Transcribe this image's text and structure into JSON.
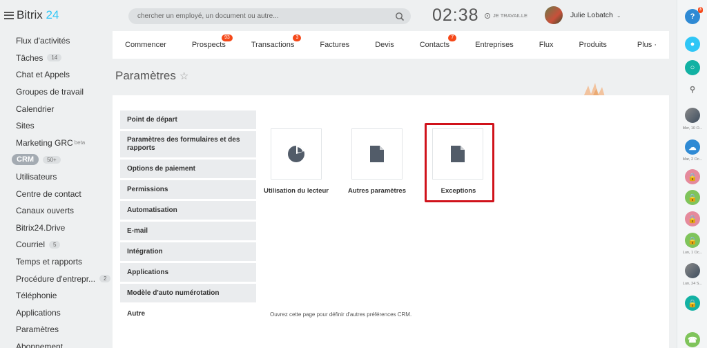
{
  "app": {
    "name_part1": "Bitrix",
    "name_part2": "24"
  },
  "search": {
    "placeholder": "chercher un employé, un document ou autre..."
  },
  "clock": {
    "time": "02:38",
    "status": "JE TRAVAILLE"
  },
  "user": {
    "name": "Julie Lobatch"
  },
  "sidebar": {
    "items": [
      {
        "label": "Flux d'activités"
      },
      {
        "label": "Tâches",
        "badge": "14"
      },
      {
        "label": "Chat et Appels"
      },
      {
        "label": "Groupes de travail"
      },
      {
        "label": "Calendrier"
      },
      {
        "label": "Sites"
      },
      {
        "label": "Marketing GRC",
        "sup": "beta"
      },
      {
        "label": "CRM",
        "badge": "50+"
      },
      {
        "label": "Utilisateurs"
      },
      {
        "label": "Centre de contact"
      },
      {
        "label": "Canaux ouverts"
      },
      {
        "label": "Bitrix24.Drive"
      },
      {
        "label": "Courriel",
        "badge": "5"
      },
      {
        "label": "Temps et rapports"
      },
      {
        "label": "Procédure d'entrepr...",
        "badge": "2"
      },
      {
        "label": "Téléphonie"
      },
      {
        "label": "Applications"
      },
      {
        "label": "Paramètres"
      },
      {
        "label": "Abonnement"
      }
    ]
  },
  "topnav": {
    "items": [
      {
        "label": "Commencer"
      },
      {
        "label": "Prospects",
        "count": "93"
      },
      {
        "label": "Transactions",
        "count": "3"
      },
      {
        "label": "Factures"
      },
      {
        "label": "Devis"
      },
      {
        "label": "Contacts",
        "count": "7"
      },
      {
        "label": "Entreprises"
      },
      {
        "label": "Flux"
      },
      {
        "label": "Produits"
      },
      {
        "label": "Plus ·"
      }
    ]
  },
  "page": {
    "title": "Paramètres",
    "star": "☆"
  },
  "settings_menu": {
    "items": [
      {
        "label": "Point de départ"
      },
      {
        "label": "Paramètres des formulaires et des rapports"
      },
      {
        "label": "Options de paiement"
      },
      {
        "label": "Permissions"
      },
      {
        "label": "Automatisation"
      },
      {
        "label": "E-mail"
      },
      {
        "label": "Intégration"
      },
      {
        "label": "Applications"
      },
      {
        "label": "Modèle d'auto numérotation"
      },
      {
        "label": "Autre"
      }
    ]
  },
  "tiles": [
    {
      "label": "Utilisation du lecteur",
      "icon": "pie-chart-icon"
    },
    {
      "label": "Autres paramètres",
      "icon": "document-icon"
    },
    {
      "label": "Exceptions",
      "icon": "document-icon"
    }
  ],
  "footnote": "Ouvrez cette page pour définir d'autres préférences CRM.",
  "rightbar": {
    "help_count": "3",
    "dates": [
      "Mer, 10 O...",
      "Mar, 2 Oc...",
      "Lun, 1 Oc...",
      "Lun, 24 S..."
    ]
  },
  "colors": {
    "accent": "#2fc6f6",
    "badge": "#f54819",
    "highlight": "#d0121b",
    "lock_pink": "#e58a9c",
    "lock_green": "#7fc45b",
    "lock_teal": "#12b1a3"
  }
}
